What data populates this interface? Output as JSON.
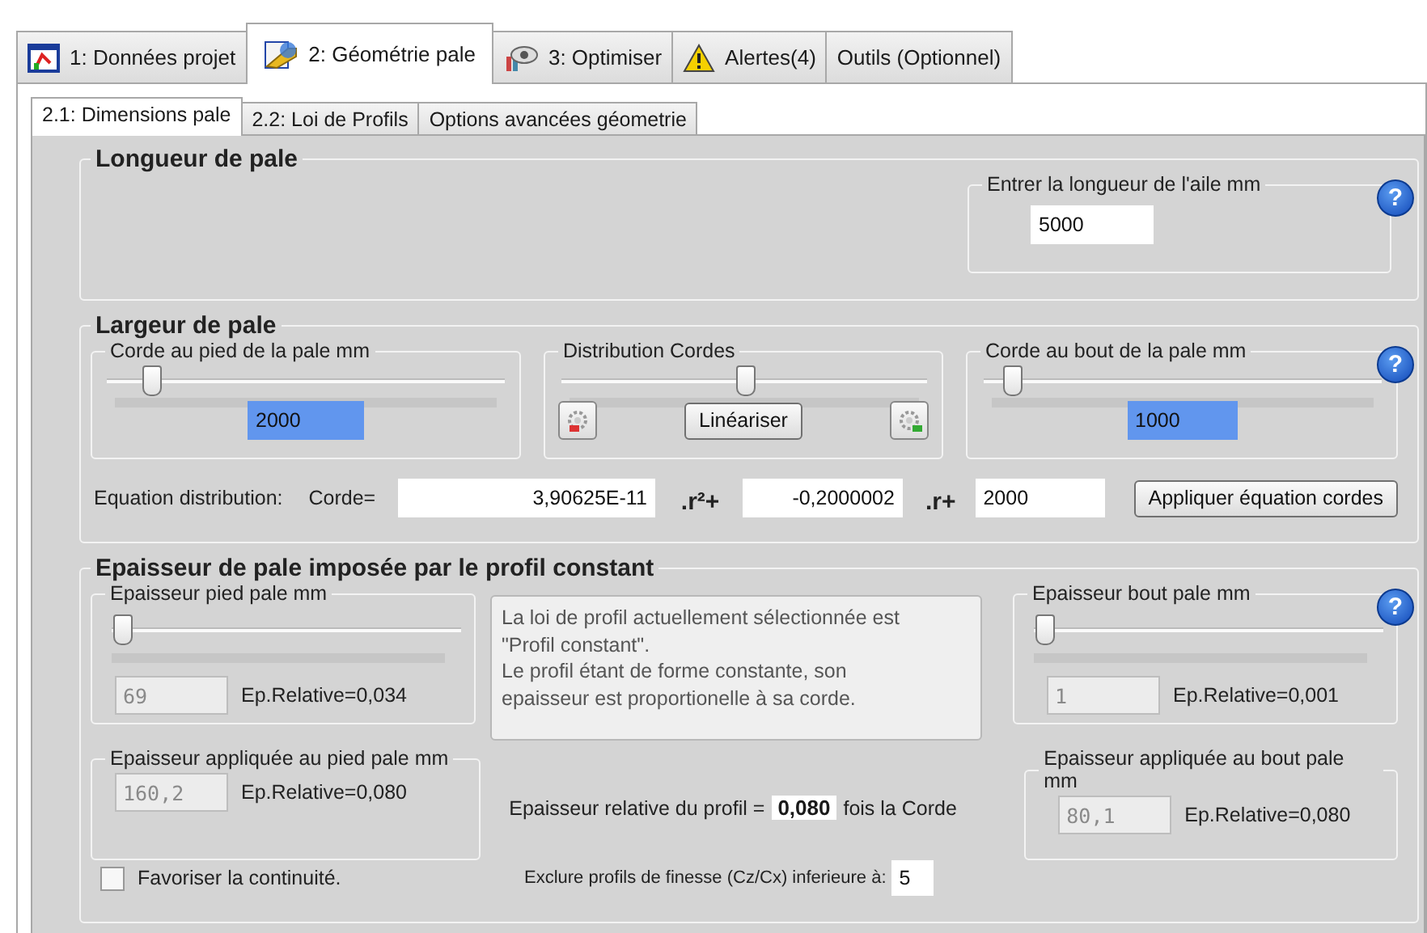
{
  "tabs": [
    {
      "label": "1: Données projet",
      "selected": false
    },
    {
      "label": "2: Géométrie pale",
      "selected": true
    },
    {
      "label": "3: Optimiser",
      "selected": false
    },
    {
      "label": "Alertes(4)",
      "selected": false
    },
    {
      "label": "Outils (Optionnel)",
      "selected": false
    }
  ],
  "subtabs": [
    {
      "label": "2.1: Dimensions pale",
      "selected": true
    },
    {
      "label": "2.2: Loi de Profils",
      "selected": false
    },
    {
      "label": "Options avancées géometrie",
      "selected": false
    }
  ],
  "length_group": {
    "title": "Longueur de pale",
    "help": "?",
    "field": {
      "label": "Entrer la longueur de l'aile mm",
      "value": "5000"
    }
  },
  "width_group": {
    "title": "Largeur de pale",
    "help": "?",
    "root": {
      "label": "Corde au pied de la pale mm",
      "level": 0.11,
      "value": "2000",
      "highlighted": true
    },
    "distribution": {
      "label": "Distribution Cordes",
      "level": 0.5,
      "button": "Linéariser"
    },
    "tip": {
      "label": "Corde au bout de la pale mm",
      "level": 0.07,
      "value": "1000",
      "highlighted": true
    },
    "equation": {
      "label": "Equation distribution:",
      "prefix": "Corde=",
      "a": "3,90625E-11",
      "r2": ".r²+",
      "b": "-0,2000002",
      "r": ".r+",
      "c": "2000",
      "button": "Appliquer équation cordes"
    }
  },
  "thickness_group": {
    "title": "Epaisseur de pale imposée par le profil constant",
    "help": "?",
    "root": {
      "label": "Epaisseur pied pale mm",
      "level": 0.03,
      "value": "69",
      "disabled": true,
      "relative": "Ep.Relative=0,034"
    },
    "info": "La loi de profil actuellement sélectionnée est\n\"Profil constant\".\nLe profil étant de forme constante, son\nepaisseur est proportionelle à  sa corde.",
    "tip": {
      "label": "Epaisseur bout pale mm",
      "level": 0.03,
      "value": "1",
      "disabled": true,
      "relative": "Ep.Relative=0,001"
    },
    "applied_root": {
      "label": "Epaisseur appliquée au pied pale mm",
      "value": "160,2",
      "disabled": true,
      "relative": "Ep.Relative=0,080"
    },
    "relative_profile": {
      "label": "Epaisseur relative du profil =",
      "value": "0,080",
      "suffix": "fois la Corde"
    },
    "applied_tip": {
      "label": "Epaisseur appliquée au bout pale mm",
      "value": "80,1",
      "disabled": true,
      "relative": "Ep.Relative=0,080"
    },
    "continuity": {
      "label": "Favoriser la continuité.",
      "checked": false
    },
    "exclude": {
      "label": "Exclure profils de finesse (Cz/Cx) inferieure à:",
      "value": "5"
    }
  }
}
